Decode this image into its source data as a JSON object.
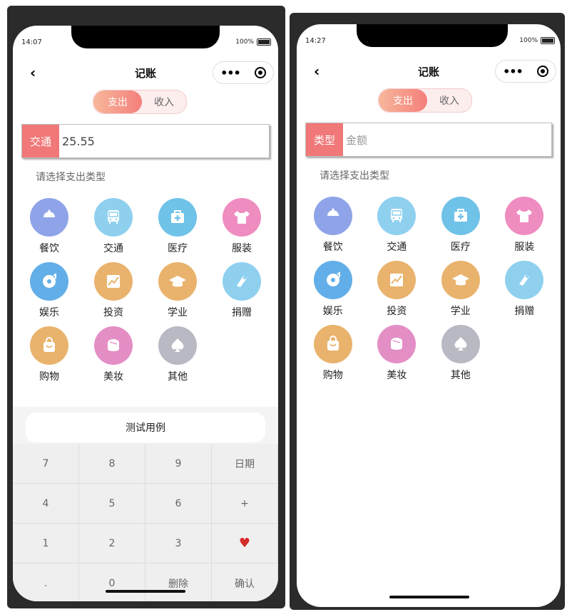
{
  "left_phone": {
    "status_time": "14:07",
    "battery": "100%",
    "nav": {
      "back": "‹",
      "title": "记账"
    },
    "toggle": {
      "active": "支出",
      "inactive": "收入"
    },
    "amount": {
      "tag": "交通",
      "value": "25.55"
    },
    "hint": "请选择支出类型",
    "categories": [
      {
        "label": "餐饮",
        "icon": "cloche-icon",
        "color": "#8fa4e8"
      },
      {
        "label": "交通",
        "icon": "bus-icon",
        "color": "#8fd0ef"
      },
      {
        "label": "医疗",
        "icon": "medkit-icon",
        "color": "#6fc2e8"
      },
      {
        "label": "服装",
        "icon": "shirt-icon",
        "color": "#ef8cc0"
      },
      {
        "label": "娱乐",
        "icon": "music-disc-icon",
        "color": "#62aee8"
      },
      {
        "label": "投资",
        "icon": "chart-trend-icon",
        "color": "#e9b36d"
      },
      {
        "label": "学业",
        "icon": "grad-cap-icon",
        "color": "#e9b36d"
      },
      {
        "label": "捐赠",
        "icon": "donate-icon",
        "color": "#8fd0ef"
      },
      {
        "label": "购物",
        "icon": "bag-icon",
        "color": "#e9b36d"
      },
      {
        "label": "美妆",
        "icon": "makeup-icon",
        "color": "#e48ec6"
      },
      {
        "label": "其他",
        "icon": "spade-icon",
        "color": "#b9b9c4"
      }
    ],
    "test_button": "测试用例",
    "keys": [
      "7",
      "8",
      "9",
      "日期",
      "4",
      "5",
      "6",
      "+",
      "1",
      "2",
      "3",
      "♥",
      ".",
      "0",
      "删除",
      "确认"
    ]
  },
  "right_phone": {
    "status_time": "14:27",
    "battery": "100%",
    "nav": {
      "back": "‹",
      "title": "记账"
    },
    "toggle": {
      "active": "支出",
      "inactive": "收入"
    },
    "amount": {
      "tag": "类型",
      "placeholder": "金额"
    },
    "hint": "请选择支出类型",
    "categories": [
      {
        "label": "餐饮",
        "icon": "cloche-icon",
        "color": "#8fa4e8"
      },
      {
        "label": "交通",
        "icon": "bus-icon",
        "color": "#8fd0ef"
      },
      {
        "label": "医疗",
        "icon": "medkit-icon",
        "color": "#6fc2e8"
      },
      {
        "label": "服装",
        "icon": "shirt-icon",
        "color": "#ef8cc0"
      },
      {
        "label": "娱乐",
        "icon": "music-disc-icon",
        "color": "#62aee8"
      },
      {
        "label": "投资",
        "icon": "chart-trend-icon",
        "color": "#e9b36d"
      },
      {
        "label": "学业",
        "icon": "grad-cap-icon",
        "color": "#e9b36d"
      },
      {
        "label": "捐赠",
        "icon": "donate-icon",
        "color": "#8fd0ef"
      },
      {
        "label": "购物",
        "icon": "bag-icon",
        "color": "#e9b36d"
      },
      {
        "label": "美妆",
        "icon": "makeup-icon",
        "color": "#e48ec6"
      },
      {
        "label": "其他",
        "icon": "spade-icon",
        "color": "#b9b9c4"
      }
    ]
  }
}
